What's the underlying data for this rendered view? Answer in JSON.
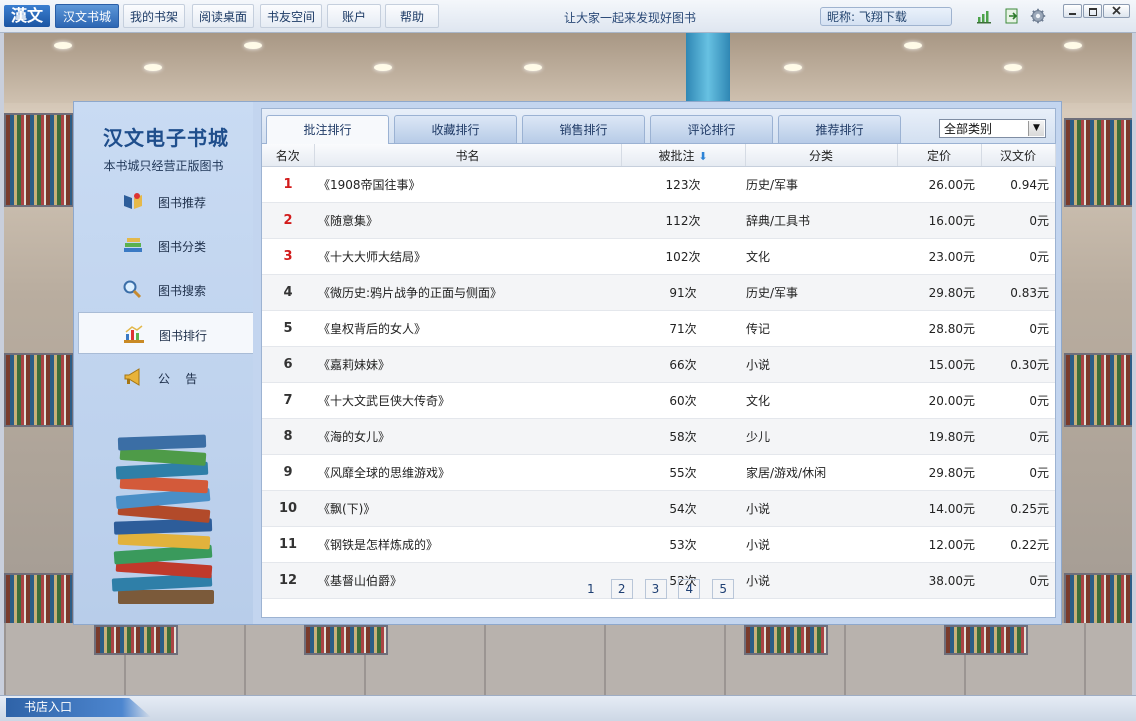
{
  "app": {
    "logo": "漢文"
  },
  "nav": {
    "items": [
      {
        "label": "汉文书城",
        "active": true
      },
      {
        "label": "我的书架"
      },
      {
        "label": "阅读桌面"
      },
      {
        "label": "书友空间"
      },
      {
        "label": "账户"
      },
      {
        "label": "帮助"
      }
    ],
    "slogan": "让大家一起来发现好图书",
    "nickname": "昵称: 飞翔下载",
    "icons": [
      "bar-chart-icon",
      "exit-icon",
      "gear-icon"
    ]
  },
  "sidebar": {
    "brand": "汉文电子书城",
    "subtitle": "本书城只经营正版图书",
    "items": [
      {
        "label": "图书推荐",
        "icon": "book-recommend-icon"
      },
      {
        "label": "图书分类",
        "icon": "book-category-icon"
      },
      {
        "label": "图书搜索",
        "icon": "magnifier-icon"
      },
      {
        "label": "图书排行",
        "icon": "ranking-chart-icon",
        "active": true
      },
      {
        "label": "公    告",
        "icon": "megaphone-icon"
      }
    ]
  },
  "tabs": [
    {
      "label": "批注排行",
      "active": true
    },
    {
      "label": "收藏排行"
    },
    {
      "label": "销售排行"
    },
    {
      "label": "评论排行"
    },
    {
      "label": "推荐排行"
    }
  ],
  "category_select": {
    "value": "全部类别"
  },
  "table": {
    "headers": [
      "名次",
      "书名",
      "被批注",
      "分类",
      "定价",
      "汉文价"
    ],
    "sort_column": "被批注",
    "rows": [
      {
        "rank": "1",
        "name": "《1908帝国往事》",
        "count": "123次",
        "category": "历史/军事",
        "price": "26.00元",
        "hw_price": "0.94元"
      },
      {
        "rank": "2",
        "name": "《随意集》",
        "count": "112次",
        "category": "辞典/工具书",
        "price": "16.00元",
        "hw_price": "0元"
      },
      {
        "rank": "3",
        "name": "《十大大师大结局》",
        "count": "102次",
        "category": "文化",
        "price": "23.00元",
        "hw_price": "0元"
      },
      {
        "rank": "4",
        "name": "《微历史:鸦片战争的正面与侧面》",
        "count": "91次",
        "category": "历史/军事",
        "price": "29.80元",
        "hw_price": "0.83元"
      },
      {
        "rank": "5",
        "name": "《皇权背后的女人》",
        "count": "71次",
        "category": "传记",
        "price": "28.80元",
        "hw_price": "0元"
      },
      {
        "rank": "6",
        "name": "《嘉莉妹妹》",
        "count": "66次",
        "category": "小说",
        "price": "15.00元",
        "hw_price": "0.30元"
      },
      {
        "rank": "7",
        "name": "《十大文武巨侠大传奇》",
        "count": "60次",
        "category": "文化",
        "price": "20.00元",
        "hw_price": "0元"
      },
      {
        "rank": "8",
        "name": "《海的女儿》",
        "count": "58次",
        "category": "少儿",
        "price": "19.80元",
        "hw_price": "0元"
      },
      {
        "rank": "9",
        "name": "《风靡全球的思维游戏》",
        "count": "55次",
        "category": "家居/游戏/休闲",
        "price": "29.80元",
        "hw_price": "0元"
      },
      {
        "rank": "10",
        "name": "《飘(下)》",
        "count": "54次",
        "category": "小说",
        "price": "14.00元",
        "hw_price": "0.25元"
      },
      {
        "rank": "11",
        "name": "《钢铁是怎样炼成的》",
        "count": "53次",
        "category": "小说",
        "price": "12.00元",
        "hw_price": "0.22元"
      },
      {
        "rank": "12",
        "name": "《基督山伯爵》",
        "count": "52次",
        "category": "小说",
        "price": "38.00元",
        "hw_price": "0元"
      }
    ]
  },
  "pager": {
    "pages": [
      "1",
      "2",
      "3",
      "4",
      "5"
    ],
    "current": "1"
  },
  "statusbar": {
    "entry": "书店入口"
  },
  "colors": {
    "accent": "#2d66b3",
    "rank_top": "#d21b1b",
    "panel": "#c3d5ef"
  }
}
